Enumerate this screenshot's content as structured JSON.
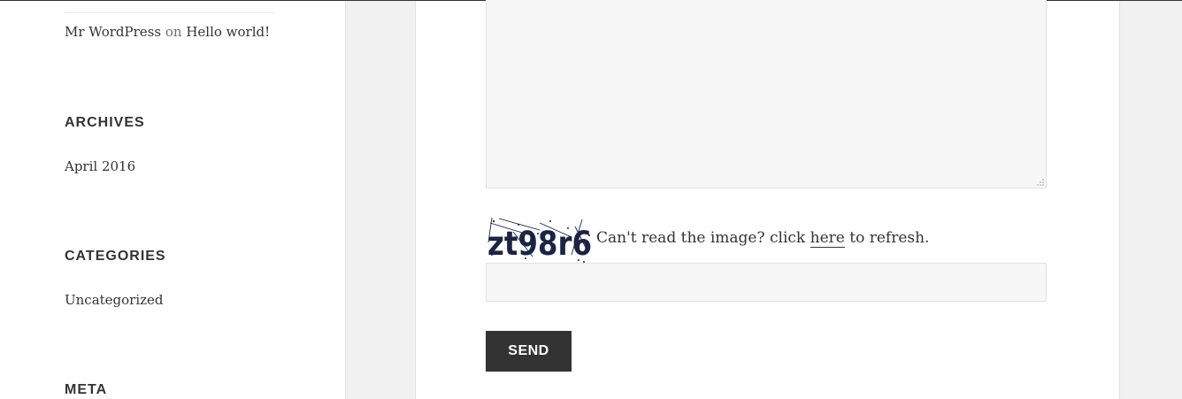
{
  "sidebar": {
    "recent_comment": {
      "author": "Mr WordPress",
      "connector": "on",
      "post": "Hello world!"
    },
    "widgets": [
      {
        "title": "ARCHIVES",
        "items": [
          "April 2016"
        ]
      },
      {
        "title": "CATEGORIES",
        "items": [
          "Uncategorized"
        ]
      },
      {
        "title": "META",
        "items": []
      }
    ]
  },
  "form": {
    "message_value": "",
    "captcha": {
      "image_text": "zt98r6",
      "prompt": "Can't read the image? click",
      "link_label": "here",
      "suffix": "to refresh.",
      "input_value": ""
    },
    "send_label": "SEND"
  },
  "colors": {
    "captcha_ink": "#1c2444",
    "button_bg": "#333333",
    "field_bg": "#f7f7f7"
  }
}
